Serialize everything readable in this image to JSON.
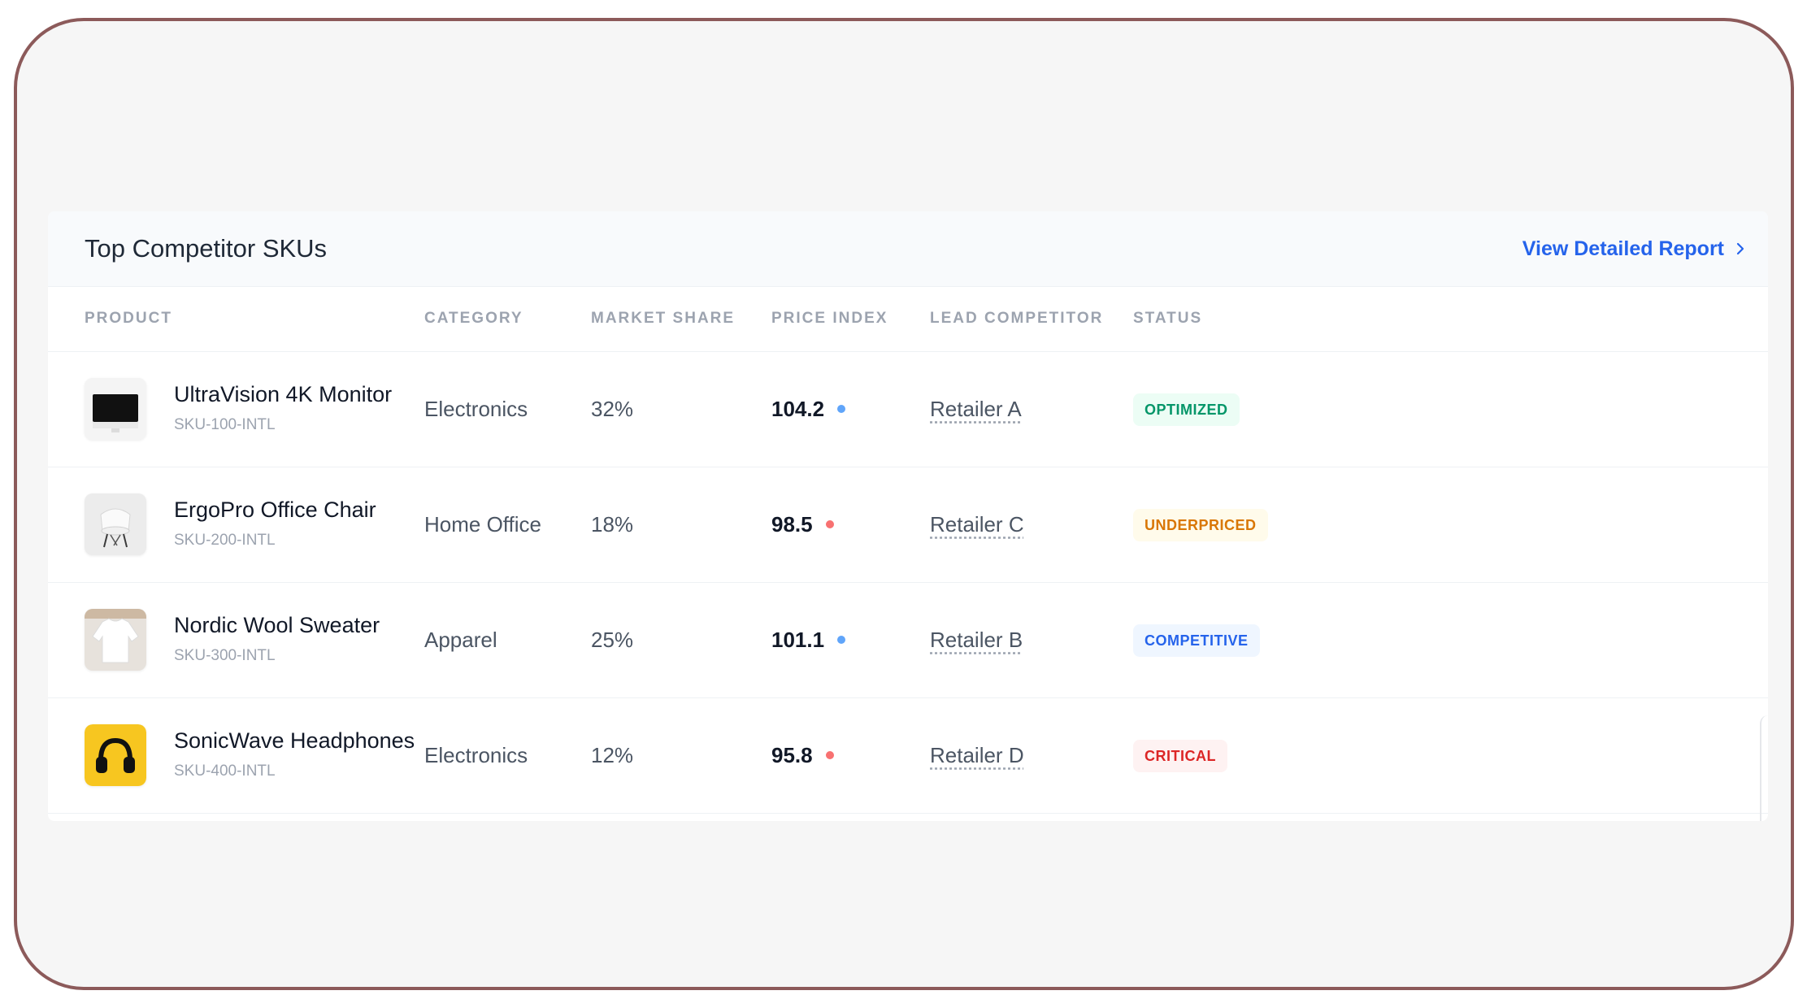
{
  "card": {
    "title": "Top Competitor SKUs",
    "view_report_label": "View Detailed Report"
  },
  "table": {
    "headers": {
      "product": "PRODUCT",
      "category": "CATEGORY",
      "market_share": "MARKET SHARE",
      "price_index": "PRICE INDEX",
      "lead_competitor": "LEAD COMPETITOR",
      "status": "STATUS"
    },
    "rows": [
      {
        "name": "UltraVision 4K Monitor",
        "sku": "SKU-100-INTL",
        "category": "Electronics",
        "market_share": "32%",
        "price_index": "104.2",
        "price_dot_color": "#60a5fa",
        "lead_competitor": "Retailer A",
        "status": "OPTIMIZED",
        "status_color": "#059669",
        "status_bg": "#ecfdf5",
        "thumb_icon": "monitor-icon"
      },
      {
        "name": "ErgoPro Office Chair",
        "sku": "SKU-200-INTL",
        "category": "Home Office",
        "market_share": "18%",
        "price_index": "98.5",
        "price_dot_color": "#f87171",
        "lead_competitor": "Retailer C",
        "status": "UNDERPRICED",
        "status_color": "#d97706",
        "status_bg": "#fffbeb",
        "thumb_icon": "chair-icon"
      },
      {
        "name": "Nordic Wool Sweater",
        "sku": "SKU-300-INTL",
        "category": "Apparel",
        "market_share": "25%",
        "price_index": "101.1",
        "price_dot_color": "#60a5fa",
        "lead_competitor": "Retailer B",
        "status": "COMPETITIVE",
        "status_color": "#2563eb",
        "status_bg": "#eff6ff",
        "thumb_icon": "sweater-icon"
      },
      {
        "name": "SonicWave Headphones",
        "sku": "SKU-400-INTL",
        "category": "Electronics",
        "market_share": "12%",
        "price_index": "95.8",
        "price_dot_color": "#f87171",
        "lead_competitor": "Retailer D",
        "status": "CRITICAL",
        "status_color": "#dc2626",
        "status_bg": "#fef2f2",
        "thumb_icon": "headphones-icon"
      }
    ]
  }
}
